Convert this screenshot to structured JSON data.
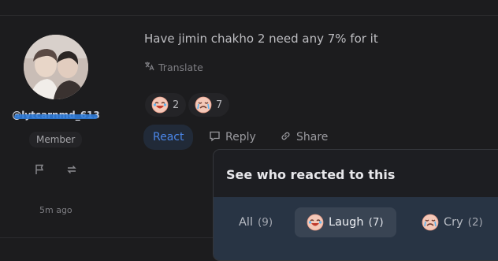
{
  "author": {
    "username": "@lytcarnmd_613",
    "role": "Member",
    "time_ago": "5m ago"
  },
  "comment": {
    "text": "Have jimin chakho 2 need any 7% for it",
    "translate_label": "Translate"
  },
  "reactions": [
    {
      "icon": "laugh-emoji-icon",
      "count": "2"
    },
    {
      "icon": "cry-emoji-icon",
      "count": "7"
    }
  ],
  "actions": {
    "react": "React",
    "reply": "Reply",
    "share": "Share"
  },
  "popup": {
    "title": "See who reacted to this",
    "tabs": [
      {
        "label": "All",
        "count": "(9)",
        "active": false
      },
      {
        "label": "Laugh",
        "count": "(7)",
        "active": true,
        "icon": "laugh-emoji-icon"
      },
      {
        "label": "Cry",
        "count": "(2)",
        "active": false,
        "icon": "cry-emoji-icon"
      }
    ]
  },
  "colors": {
    "background": "#1c1c1e",
    "accent": "#4a86e8",
    "popup_band": "#283444"
  }
}
